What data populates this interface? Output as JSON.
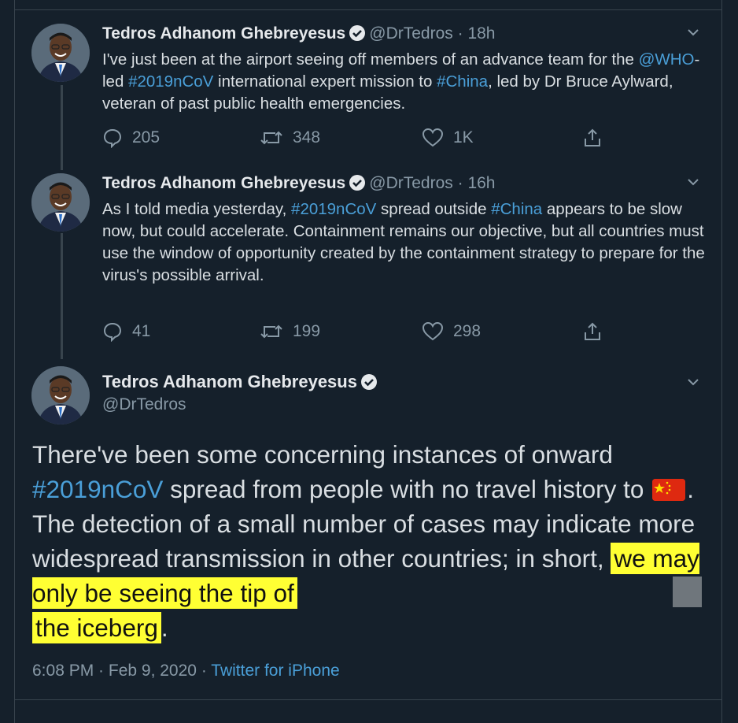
{
  "tweets": [
    {
      "name": "Tedros Adhanom Ghebreyesus",
      "handle": "@DrTedros",
      "separator": "·",
      "time": "18h",
      "text_parts": [
        "I've just been at the airport seeing off members of an advance team for the ",
        "@WHO",
        "-led ",
        "#2019nCoV",
        " international expert mission to ",
        "#China",
        ", led by Dr Bruce Aylward, veteran of past public health emergencies."
      ],
      "replies": "205",
      "retweets": "348",
      "likes": "1K"
    },
    {
      "name": "Tedros Adhanom Ghebreyesus",
      "handle": "@DrTedros",
      "separator": "·",
      "time": "16h",
      "text_parts": [
        "As I told media yesterday, ",
        "#2019nCoV",
        " spread outside ",
        "#China",
        " appears to be slow now, but could accelerate. Containment remains our objective, but all countries must use the window of opportunity created by the containment strategy to prepare for the virus's possible arrival."
      ],
      "replies": "41",
      "retweets": "199",
      "likes": "298"
    }
  ],
  "main_tweet": {
    "name": "Tedros Adhanom Ghebreyesus",
    "handle": "@DrTedros",
    "text_parts": [
      "There've been some concerning instances of onward ",
      "#2019nCoV",
      " spread from people with no travel history to ",
      ". The detection of a small number of cases may indicate more widespread transmission in other countries; in short, ",
      "we may only be seeing the tip of ",
      "the iceberg",
      "."
    ],
    "date_time": "6:08 PM · Feb 9, 2020",
    "separator": "·",
    "source": "Twitter for iPhone"
  },
  "icons": {
    "verified": "verified-badge-icon",
    "reply": "reply-icon",
    "retweet": "retweet-icon",
    "like": "like-icon",
    "share": "share-icon",
    "more": "chevron-down-icon",
    "flag": "china-flag-icon"
  },
  "colors": {
    "background": "#15202b",
    "link": "#4a9fd8",
    "muted": "#8899a6",
    "highlight": "#ffff33",
    "border": "#38444d"
  }
}
